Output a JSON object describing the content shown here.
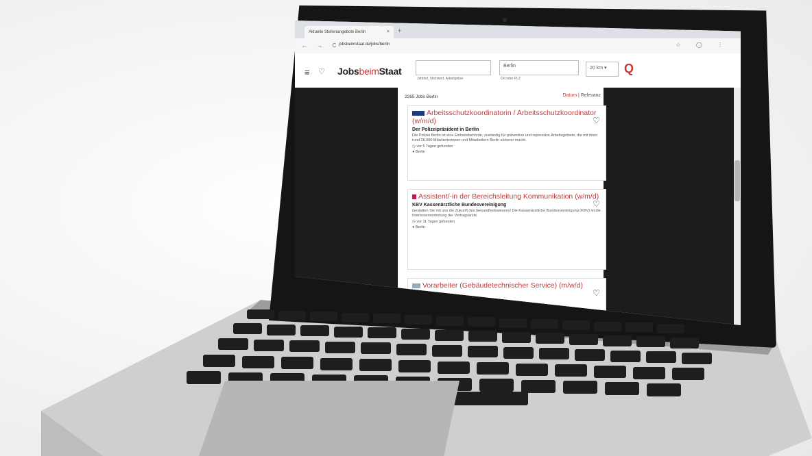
{
  "browser": {
    "tab_title": "Aktuelle Stellenangebote Berlin",
    "tab_close": "×",
    "new_tab": "+",
    "window_controls": "—  ▢  ✕",
    "nav_icons": "← → C",
    "url": "jobsbeimstaat.de/jobs/berlin",
    "right_icons": "☆ ◯ ⋮"
  },
  "site": {
    "logo_left": "Jobs",
    "logo_mid": "beim",
    "logo_right": "Staat",
    "search_what_placeholder": "",
    "search_what_hint": "Jobtitel, Stichwort, Arbeitgeber",
    "search_where_value": "Berlin",
    "search_where_hint": "Ort oder PLZ",
    "radius": "20 km",
    "menu_icon": "≡",
    "heart_icon": "♡",
    "search_icon": "Q"
  },
  "results": {
    "count": "2265 Jobs Berlin",
    "sort_active": "Datum",
    "sort_sep": "|",
    "sort_other": "Relevanz"
  },
  "jobs": [
    {
      "title": "Arbeitsschutzkoordinatorin / Arbeitsschutzkoordinator (w/m/d)",
      "org": "Der Polizeipräsident in Berlin",
      "desc": "Die Polizei Berlin ist eine Einheitsbehörde, zuständig für präventive und repressive Arbeitsgebiete, die mit ihren rund 26.000 Mitarbeiterinnen und Mitarbeitern Berlin sicherer macht.",
      "age": "vor 5 Tagen gefunden",
      "location": "Berlin",
      "heart": "♡"
    },
    {
      "title": "Assistent/-in der Bereichsleitung Kommunikation (w/m/d)",
      "org": "KBV Kassenärztliche Bundesvereinigung",
      "desc": "Gestalten Sie mit uns die Zukunft des Gesundheitswesens! Die Kassenärztliche Bundesvereinigung (KBV) ist die Interessenvertretung der Vertragsärzte.",
      "age": "vor 11 Tagen gefunden",
      "location": "Berlin",
      "heart": "♡"
    },
    {
      "title": "Vorarbeiter (Gebäudetechnischer Service) (m/w/d)",
      "org": "",
      "desc": "",
      "age": "",
      "location": "",
      "heart": "♡"
    }
  ]
}
